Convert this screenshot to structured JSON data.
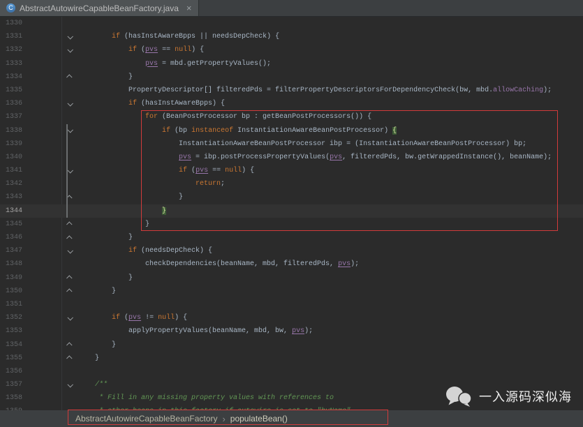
{
  "colors": {
    "bg": "#2b2b2b",
    "tabbar_bg": "#3c3f41",
    "tab_bg": "#4e5254",
    "tab_text": "#bbbbbb",
    "bar_bg": "#3c3f41",
    "gutter_text": "#606366",
    "plain": "#a9b7c6",
    "keyword": "#cc7832",
    "field": "#9876aa",
    "comment": "#629755",
    "caret_row": "#323232",
    "annotation": "#d23b3b",
    "brace_text": "#d8e6a0",
    "brace_bg": "#3c5a36"
  },
  "window": {
    "tab": {
      "icon_letter": "C",
      "title": "AbstractAutowireCapableBeanFactory.java",
      "close_glyph": "×"
    }
  },
  "editor": {
    "current_line": "1344",
    "lines": [
      {
        "num": "1330",
        "fold": "",
        "current": false,
        "t": []
      },
      {
        "num": "1331",
        "fold": "d",
        "current": false,
        "t": [
          [
            "p",
            "        "
          ],
          [
            "k",
            "if"
          ],
          [
            "p",
            " (hasInstAwareBpps || needsDepCheck) {"
          ]
        ]
      },
      {
        "num": "1332",
        "fold": "d",
        "current": false,
        "t": [
          [
            "p",
            "            "
          ],
          [
            "k",
            "if"
          ],
          [
            "p",
            " ("
          ],
          [
            "f",
            "pvs"
          ],
          [
            "p",
            " == "
          ],
          [
            "k",
            "null"
          ],
          [
            "p",
            ") {"
          ]
        ]
      },
      {
        "num": "1333",
        "fold": "",
        "current": false,
        "t": [
          [
            "p",
            "                "
          ],
          [
            "f",
            "pvs"
          ],
          [
            "p",
            " = mbd.getPropertyValues();"
          ]
        ]
      },
      {
        "num": "1334",
        "fold": "u",
        "current": false,
        "t": [
          [
            "p",
            "            }"
          ]
        ]
      },
      {
        "num": "1335",
        "fold": "",
        "current": false,
        "t": [
          [
            "p",
            "            PropertyDescriptor[] filteredPds = filterPropertyDescriptorsForDependencyCheck(bw, mbd."
          ],
          [
            "d",
            "allowCaching"
          ],
          [
            "p",
            ");"
          ]
        ]
      },
      {
        "num": "1336",
        "fold": "d",
        "current": false,
        "t": [
          [
            "p",
            "            "
          ],
          [
            "k",
            "if"
          ],
          [
            "p",
            " (hasInstAwareBpps) {"
          ]
        ]
      },
      {
        "num": "1337",
        "fold": "",
        "current": false,
        "t": [
          [
            "p",
            "                "
          ],
          [
            "k",
            "for"
          ],
          [
            "p",
            " (BeanPostProcessor bp : getBeanPostProcessors()) {"
          ]
        ]
      },
      {
        "num": "1338",
        "fold": "d",
        "current": false,
        "t": [
          [
            "p",
            "                    "
          ],
          [
            "k",
            "if"
          ],
          [
            "p",
            " (bp "
          ],
          [
            "k",
            "instanceof"
          ],
          [
            "p",
            " InstantiationAwareBeanPostProcessor) "
          ],
          [
            "b",
            "{"
          ]
        ]
      },
      {
        "num": "1339",
        "fold": "",
        "current": false,
        "t": [
          [
            "p",
            "                        InstantiationAwareBeanPostProcessor ibp = (InstantiationAwareBeanPostProcessor) bp;"
          ]
        ]
      },
      {
        "num": "1340",
        "fold": "",
        "current": false,
        "t": [
          [
            "p",
            "                        "
          ],
          [
            "f",
            "pvs"
          ],
          [
            "p",
            " = ibp.postProcessPropertyValues("
          ],
          [
            "f",
            "pvs"
          ],
          [
            "p",
            ", filteredPds, bw.getWrappedInstance(), beanName);"
          ]
        ]
      },
      {
        "num": "1341",
        "fold": "d",
        "current": false,
        "t": [
          [
            "p",
            "                        "
          ],
          [
            "k",
            "if"
          ],
          [
            "p",
            " ("
          ],
          [
            "f",
            "pvs"
          ],
          [
            "p",
            " == "
          ],
          [
            "k",
            "null"
          ],
          [
            "p",
            ") {"
          ]
        ]
      },
      {
        "num": "1342",
        "fold": "",
        "current": false,
        "t": [
          [
            "p",
            "                            "
          ],
          [
            "k",
            "return"
          ],
          [
            "p",
            ";"
          ]
        ]
      },
      {
        "num": "1343",
        "fold": "u",
        "current": false,
        "t": [
          [
            "p",
            "                        }"
          ]
        ]
      },
      {
        "num": "1344",
        "fold": "",
        "current": true,
        "t": [
          [
            "p",
            "                    "
          ],
          [
            "b",
            "}"
          ]
        ]
      },
      {
        "num": "1345",
        "fold": "u",
        "current": false,
        "t": [
          [
            "p",
            "                }"
          ]
        ]
      },
      {
        "num": "1346",
        "fold": "u",
        "current": false,
        "t": [
          [
            "p",
            "            }"
          ]
        ]
      },
      {
        "num": "1347",
        "fold": "d",
        "current": false,
        "t": [
          [
            "p",
            "            "
          ],
          [
            "k",
            "if"
          ],
          [
            "p",
            " (needsDepCheck) {"
          ]
        ]
      },
      {
        "num": "1348",
        "fold": "",
        "current": false,
        "t": [
          [
            "p",
            "                checkDependencies(beanName, mbd, filteredPds, "
          ],
          [
            "f",
            "pvs"
          ],
          [
            "p",
            ");"
          ]
        ]
      },
      {
        "num": "1349",
        "fold": "u",
        "current": false,
        "t": [
          [
            "p",
            "            }"
          ]
        ]
      },
      {
        "num": "1350",
        "fold": "u",
        "current": false,
        "t": [
          [
            "p",
            "        }"
          ]
        ]
      },
      {
        "num": "1351",
        "fold": "",
        "current": false,
        "t": []
      },
      {
        "num": "1352",
        "fold": "d",
        "current": false,
        "t": [
          [
            "p",
            "        "
          ],
          [
            "k",
            "if"
          ],
          [
            "p",
            " ("
          ],
          [
            "f",
            "pvs"
          ],
          [
            "p",
            " != "
          ],
          [
            "k",
            "null"
          ],
          [
            "p",
            ") {"
          ]
        ]
      },
      {
        "num": "1353",
        "fold": "",
        "current": false,
        "t": [
          [
            "p",
            "            applyPropertyValues(beanName, mbd, bw, "
          ],
          [
            "f",
            "pvs"
          ],
          [
            "p",
            ");"
          ]
        ]
      },
      {
        "num": "1354",
        "fold": "u",
        "current": false,
        "t": [
          [
            "p",
            "        }"
          ]
        ]
      },
      {
        "num": "1355",
        "fold": "u",
        "current": false,
        "t": [
          [
            "p",
            "    }"
          ]
        ]
      },
      {
        "num": "1356",
        "fold": "",
        "current": false,
        "t": []
      },
      {
        "num": "1357",
        "fold": "d",
        "current": false,
        "t": [
          [
            "c",
            "    /**"
          ]
        ]
      },
      {
        "num": "1358",
        "fold": "",
        "current": false,
        "t": [
          [
            "c",
            "     * Fill in any missing property values with references to"
          ]
        ]
      },
      {
        "num": "1359",
        "fold": "",
        "current": false,
        "t": [
          [
            "c",
            "     * other beans in this factory if autowire is set to \"byName\""
          ]
        ]
      }
    ]
  },
  "breadcrumbs": {
    "separator": "›",
    "items": [
      "AbstractAutowireCapableBeanFactory",
      "populateBean()"
    ]
  },
  "watermark": {
    "text": "一入源码深似海"
  }
}
